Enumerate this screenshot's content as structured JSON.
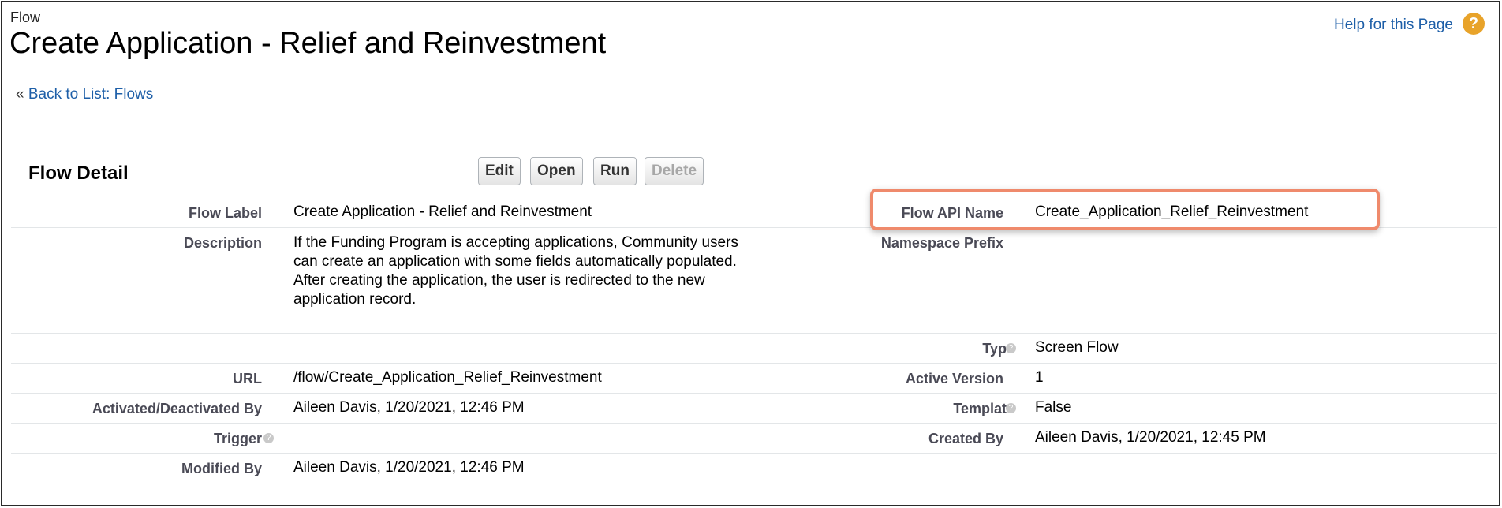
{
  "header": {
    "type_label": "Flow",
    "title": "Create Application - Relief and Reinvestment",
    "help_link": "Help for this Page",
    "help_icon": "?"
  },
  "breadcrumb": {
    "prefix": "«",
    "link": "Back to List: Flows"
  },
  "detail": {
    "section_title": "Flow Detail",
    "buttons": {
      "edit": "Edit",
      "open": "Open",
      "run": "Run",
      "delete": "Delete"
    },
    "info_glyph": "?",
    "fields": {
      "flow_label": {
        "label": "Flow Label",
        "value": "Create Application - Relief and Reinvestment"
      },
      "flow_api_name": {
        "label": "Flow API Name",
        "value": "Create_Application_Relief_Reinvestment"
      },
      "description": {
        "label": "Description",
        "value": "If the Funding Program is accepting applications, Community users can create an application with some fields automatically populated. After creating the application, the user is redirected to the new application record."
      },
      "namespace_prefix": {
        "label": "Namespace Prefix",
        "value": ""
      },
      "type": {
        "label": "Type",
        "value": "Screen Flow"
      },
      "url": {
        "label": "URL",
        "value": "/flow/Create_Application_Relief_Reinvestment"
      },
      "active_version": {
        "label": "Active Version",
        "value": "1"
      },
      "activated_by": {
        "label": "Activated/Deactivated By",
        "user": "Aileen Davis",
        "date": ", 1/20/2021, 12:46 PM"
      },
      "template": {
        "label": "Template",
        "value": "False"
      },
      "trigger": {
        "label": "Trigger",
        "value": ""
      },
      "created_by": {
        "label": "Created By",
        "user": "Aileen Davis",
        "date": ", 1/20/2021, 12:45 PM"
      },
      "modified_by": {
        "label": "Modified By",
        "user": "Aileen Davis",
        "date": ", 1/20/2021, 12:46 PM"
      }
    }
  },
  "colors": {
    "link": "#1e5fa8",
    "highlight": "#ef8a6c",
    "label": "#4a4a56",
    "help_icon": "#e8a32a"
  }
}
